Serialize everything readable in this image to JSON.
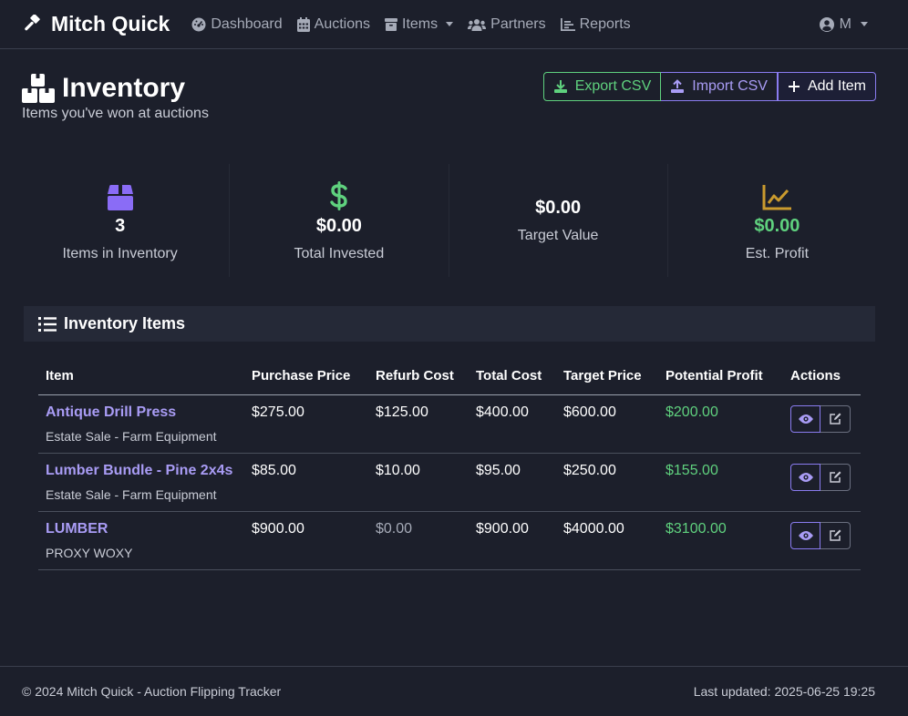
{
  "brand": {
    "name": "Mitch Quick"
  },
  "nav": {
    "dashboard": "Dashboard",
    "auctions": "Auctions",
    "items": "Items",
    "partners": "Partners",
    "reports": "Reports",
    "user": "M"
  },
  "header": {
    "title": "Inventory",
    "subtitle": "Items you've won at auctions",
    "export_label": "Export CSV",
    "import_label": "Import CSV",
    "add_label": "Add Item"
  },
  "stats": [
    {
      "value": "3",
      "label": "Items in Inventory",
      "icon": "box-icon",
      "color": "#8a6cf6"
    },
    {
      "value": "$0.00",
      "label": "Total Invested",
      "icon": "dollar-icon",
      "color": "#5fd17e"
    },
    {
      "value": "$0.00",
      "label": "Target Value",
      "icon": "none",
      "color": "#ffffff"
    },
    {
      "value": "$0.00",
      "label": "Est. Profit",
      "icon": "chart-line-icon",
      "color": "#c99a2e"
    }
  ],
  "card": {
    "title": "Inventory Items"
  },
  "table": {
    "headers": [
      "Item",
      "Purchase Price",
      "Refurb Cost",
      "Total Cost",
      "Target Price",
      "Potential Profit",
      "Actions"
    ],
    "rows": [
      {
        "name": "Antique Drill Press",
        "source": "Estate Sale - Farm Equipment",
        "purchase": "$275.00",
        "refurb": "$125.00",
        "total": "$400.00",
        "target": "$600.00",
        "profit": "$200.00"
      },
      {
        "name": "Lumber Bundle - Pine 2x4s",
        "source": "Estate Sale - Farm Equipment",
        "purchase": "$85.00",
        "refurb": "$10.00",
        "total": "$95.00",
        "target": "$250.00",
        "profit": "$155.00"
      },
      {
        "name": "LUMBER",
        "source": "PROXY WOXY",
        "purchase": "$900.00",
        "refurb": "$0.00",
        "total": "$900.00",
        "target": "$4000.00",
        "profit": "$3100.00"
      }
    ]
  },
  "footer": {
    "copyright": "© 2024 Mitch Quick - Auction Flipping Tracker",
    "updated": "Last updated: 2025-06-25 19:25"
  },
  "colors": {
    "accent": "#8a7cf0",
    "success": "#5fd17e",
    "warning": "#c99a2e",
    "background": "#1c1f2b"
  }
}
